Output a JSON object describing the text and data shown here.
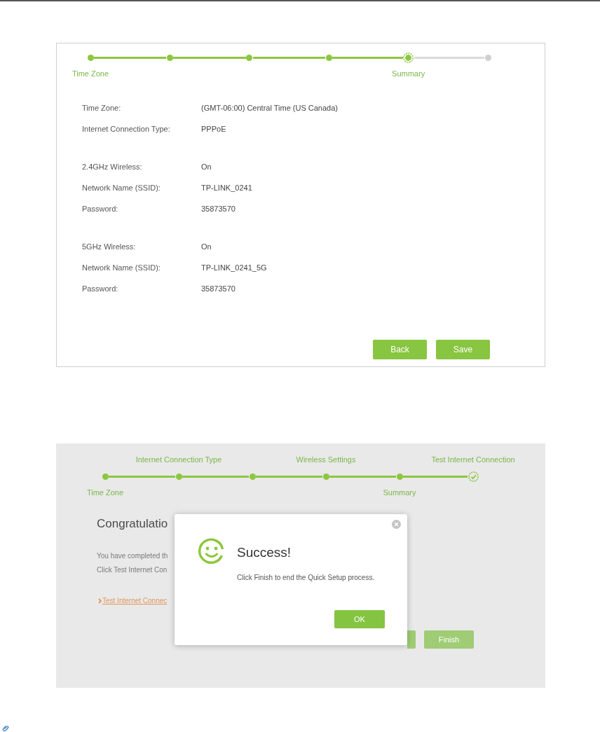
{
  "summary_panel": {
    "stepper": {
      "steps": [
        {
          "label": "Time Zone",
          "completed": true,
          "selected": false
        },
        {
          "completed": true,
          "selected": false
        },
        {
          "completed": true,
          "selected": false
        },
        {
          "completed": true,
          "selected": false
        },
        {
          "label": "Summary",
          "completed": false,
          "selected": true
        },
        {
          "completed": false,
          "selected": false
        }
      ]
    },
    "sections": [
      {
        "rows": [
          {
            "label": "Time Zone:",
            "value": "(GMT-06:00) Central Time (US Canada)"
          },
          {
            "label": "Internet Connection Type:",
            "value": "PPPoE"
          }
        ]
      },
      {
        "rows": [
          {
            "label": "2.4GHz Wireless:",
            "value": "On"
          },
          {
            "label": "Network Name (SSID):",
            "value": "TP-LINK_0241"
          },
          {
            "label": "Password:",
            "value": "35873570"
          }
        ]
      },
      {
        "rows": [
          {
            "label": "5GHz Wireless:",
            "value": "On"
          },
          {
            "label": "Network Name (SSID):",
            "value": "TP-LINK_0241_5G"
          },
          {
            "label": "Password:",
            "value": "35873570"
          }
        ]
      }
    ],
    "buttons": [
      {
        "label": "Back"
      },
      {
        "label": "Save"
      }
    ]
  },
  "success_screen": {
    "stepper": {
      "steps": [
        {
          "label": "Time Zone",
          "completed": true,
          "selected": false
        },
        {
          "label": "Internet Connection Type",
          "completed": true,
          "selected": false
        },
        {
          "completed": true,
          "selected": false
        },
        {
          "label": "Wireless Settings",
          "completed": true,
          "selected": false
        },
        {
          "label": "Summary",
          "completed": true,
          "selected": false
        },
        {
          "label": "Test Internet Connection",
          "completed": true,
          "selected": true
        }
      ]
    },
    "heading": "Congratulatio",
    "lines": [
      "You have completed th",
      "Click Test Internet Con"
    ],
    "link": "Test Internet Connec",
    "buttons": [
      {
        "kind": "covered"
      },
      {
        "kind": "labeled",
        "label": "Finish"
      }
    ],
    "dialog": {
      "title": "Success!",
      "message": "Click Finish to end the Quick Setup process.",
      "button": "OK"
    }
  }
}
